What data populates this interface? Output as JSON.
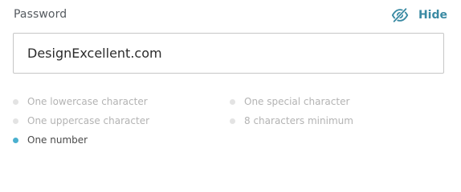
{
  "field": {
    "label": "Password",
    "value": "DesignExcellent.com",
    "toggle_label": "Hide"
  },
  "colors": {
    "accent": "#3a8aa3",
    "met_dot": "#4ab0cf",
    "unmet_dot": "#e3e3e3",
    "unmet_text": "#b3b3b3"
  },
  "icons": {
    "toggle": "eye-slash-icon"
  },
  "requirements": [
    {
      "label": "One lowercase character",
      "met": false
    },
    {
      "label": "One uppercase character",
      "met": false
    },
    {
      "label": "One number",
      "met": true
    },
    {
      "label": "One special character",
      "met": false
    },
    {
      "label": "8 characters minimum",
      "met": false
    }
  ]
}
